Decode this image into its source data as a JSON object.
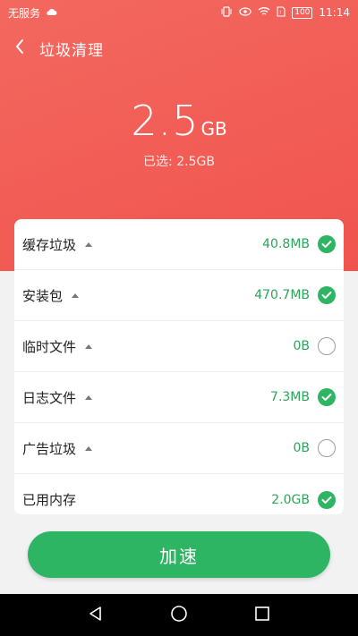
{
  "status_bar": {
    "carrier": "无服务",
    "battery": "100",
    "time": "11:14"
  },
  "header": {
    "title": "垃圾清理"
  },
  "summary": {
    "total_value": "2.5",
    "total_unit": "GB",
    "selected_text": "已选: 2.5GB"
  },
  "items": [
    {
      "label": "缓存垃圾",
      "size": "40.8MB",
      "checked": true
    },
    {
      "label": "安装包",
      "size": "470.7MB",
      "checked": true
    },
    {
      "label": "临时文件",
      "size": "0B",
      "checked": false
    },
    {
      "label": "日志文件",
      "size": "7.3MB",
      "checked": true
    },
    {
      "label": "广告垃圾",
      "size": "0B",
      "checked": false
    },
    {
      "label": "已用内存",
      "size": "2.0GB",
      "checked": true
    }
  ],
  "action": {
    "label": "加速"
  },
  "colors": {
    "hero": "#f0544e",
    "accent_green": "#2db563",
    "size_text": "#2aa55a"
  }
}
